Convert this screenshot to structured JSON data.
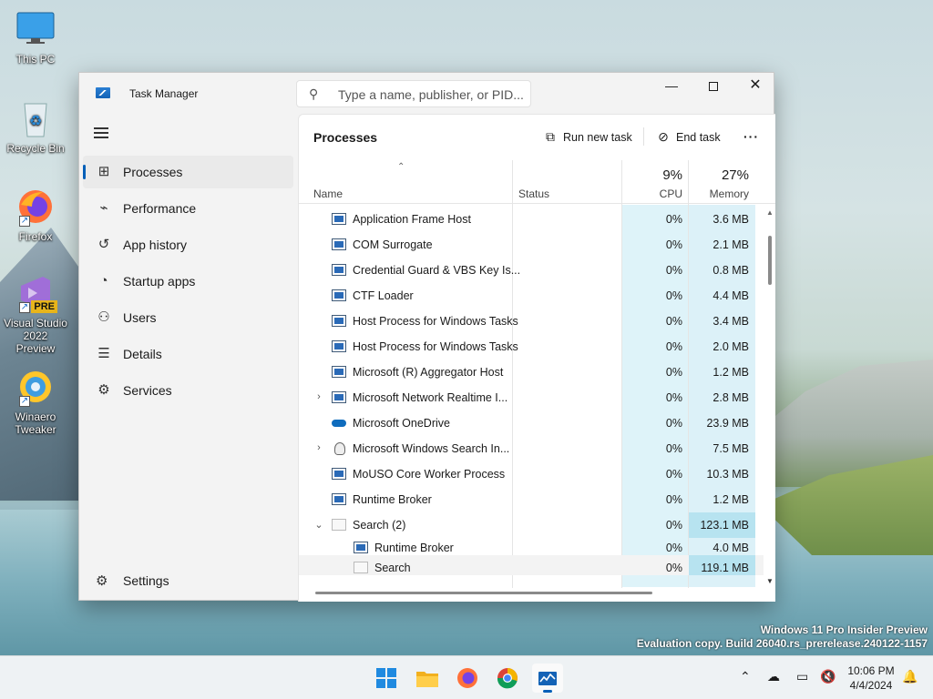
{
  "desktop": {
    "icons": [
      {
        "label": "This PC"
      },
      {
        "label": "Recycle Bin"
      },
      {
        "label": "Firefox"
      },
      {
        "label": "Visual Studio 2022 Preview",
        "badge": "PRE"
      },
      {
        "label": "Winaero Tweaker"
      }
    ],
    "watermark": {
      "line1": "Windows 11 Pro Insider Preview",
      "line2": "Evaluation copy. Build 26040.rs_prerelease.240122-1157"
    }
  },
  "window": {
    "title": "Task Manager",
    "search_placeholder": "Type a name, publisher, or PID...",
    "controls": {
      "minimize": "—",
      "maximize": "□",
      "close": "✕"
    }
  },
  "sidebar": {
    "items": [
      {
        "label": "Processes",
        "icon": "processes-icon",
        "active": true
      },
      {
        "label": "Performance",
        "icon": "performance-icon"
      },
      {
        "label": "App history",
        "icon": "app-history-icon"
      },
      {
        "label": "Startup apps",
        "icon": "startup-icon"
      },
      {
        "label": "Users",
        "icon": "users-icon"
      },
      {
        "label": "Details",
        "icon": "details-icon"
      },
      {
        "label": "Services",
        "icon": "services-icon"
      }
    ],
    "settings_label": "Settings"
  },
  "main": {
    "title": "Processes",
    "toolbar": {
      "run_new_task": "Run new task",
      "end_task": "End task",
      "more": "···"
    },
    "columns": {
      "name": "Name",
      "status": "Status",
      "cpu_total": "9%",
      "cpu": "CPU",
      "memory_total": "27%",
      "memory": "Memory"
    },
    "rows": [
      {
        "name": "Application Frame Host",
        "cpu": "0%",
        "mem": "3.6 MB",
        "icon": "app"
      },
      {
        "name": "COM Surrogate",
        "cpu": "0%",
        "mem": "2.1 MB",
        "icon": "app"
      },
      {
        "name": "Credential Guard & VBS Key Is...",
        "cpu": "0%",
        "mem": "0.8 MB",
        "icon": "app"
      },
      {
        "name": "CTF Loader",
        "cpu": "0%",
        "mem": "4.4 MB",
        "icon": "app"
      },
      {
        "name": "Host Process for Windows Tasks",
        "cpu": "0%",
        "mem": "3.4 MB",
        "icon": "app"
      },
      {
        "name": "Host Process for Windows Tasks",
        "cpu": "0%",
        "mem": "2.0 MB",
        "icon": "app"
      },
      {
        "name": "Microsoft (R) Aggregator Host",
        "cpu": "0%",
        "mem": "1.2 MB",
        "icon": "app"
      },
      {
        "name": "Microsoft Network Realtime I...",
        "cpu": "0%",
        "mem": "2.8 MB",
        "icon": "app",
        "expander": "›"
      },
      {
        "name": "Microsoft OneDrive",
        "cpu": "0%",
        "mem": "23.9 MB",
        "icon": "cloud"
      },
      {
        "name": "Microsoft Windows Search In...",
        "cpu": "0%",
        "mem": "7.5 MB",
        "icon": "person",
        "expander": "›"
      },
      {
        "name": "MoUSO Core Worker Process",
        "cpu": "0%",
        "mem": "10.3 MB",
        "icon": "app"
      },
      {
        "name": "Runtime Broker",
        "cpu": "0%",
        "mem": "1.2 MB",
        "icon": "app"
      },
      {
        "name": "Search (2)",
        "cpu": "0%",
        "mem": "123.1 MB",
        "icon": "blank",
        "expander": "⌄",
        "highlight": true
      },
      {
        "name": "Runtime Broker",
        "cpu": "0%",
        "mem": "4.0 MB",
        "icon": "app",
        "child": true
      },
      {
        "name": "Search",
        "cpu": "0%",
        "mem": "119.1 MB",
        "icon": "blank",
        "child": true,
        "highlight": true,
        "selected": true
      }
    ]
  },
  "taskbar": {
    "apps": [
      "start-icon",
      "file-explorer-icon",
      "firefox-icon",
      "chrome-icon",
      "task-manager-icon"
    ],
    "clock_time": "10:06 PM",
    "clock_date": "4/4/2024"
  },
  "colors": {
    "accent": "#005fb8",
    "cpu_column": "#def3f9",
    "mem_column": "#dcf1f8",
    "mem_high": "#b7e3f0"
  }
}
